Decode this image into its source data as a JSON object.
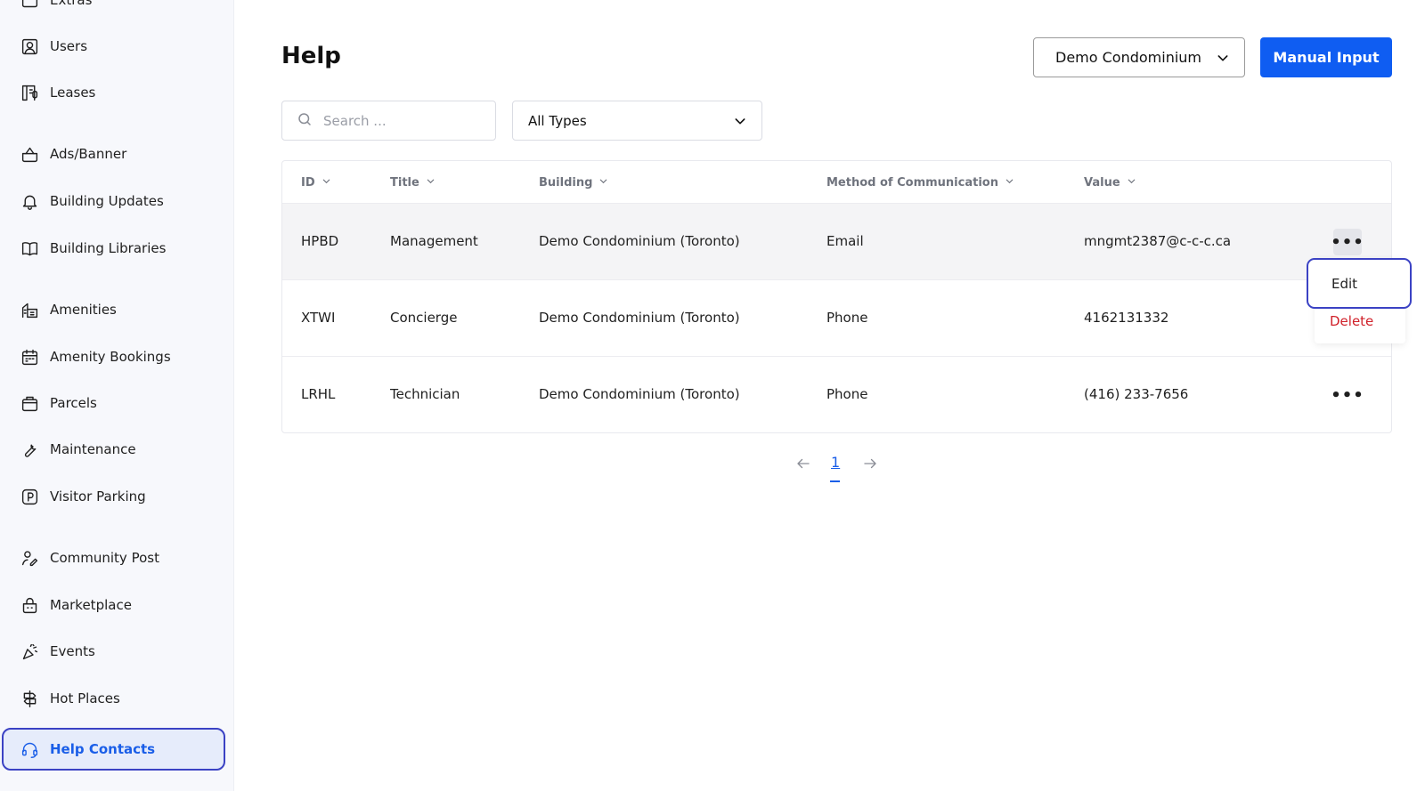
{
  "sidebar": {
    "items": [
      {
        "label": "Extras",
        "icon": "extras-icon"
      },
      {
        "label": "Users",
        "icon": "user-icon"
      },
      {
        "label": "Leases",
        "icon": "lease-icon"
      },
      {
        "label": "Ads/Banner",
        "icon": "basket-icon"
      },
      {
        "label": "Building Updates",
        "icon": "bell-icon"
      },
      {
        "label": "Building Libraries",
        "icon": "book-icon"
      },
      {
        "label": "Amenities",
        "icon": "building-icon"
      },
      {
        "label": "Amenity Bookings",
        "icon": "calendar-icon"
      },
      {
        "label": "Parcels",
        "icon": "parcel-icon"
      },
      {
        "label": "Maintenance",
        "icon": "wrench-icon"
      },
      {
        "label": "Visitor Parking",
        "icon": "parking-icon"
      },
      {
        "label": "Community Post",
        "icon": "community-icon"
      },
      {
        "label": "Marketplace",
        "icon": "marketplace-icon"
      },
      {
        "label": "Events",
        "icon": "party-icon"
      },
      {
        "label": "Hot Places",
        "icon": "signpost-icon"
      },
      {
        "label": "Help Contacts",
        "icon": "headset-icon",
        "active": true
      }
    ]
  },
  "header": {
    "title": "Help",
    "building_select": "Demo Condominium",
    "manual_input_label": "Manual Input"
  },
  "filters": {
    "search_placeholder": "Search ...",
    "type_select": "All Types"
  },
  "table": {
    "columns": [
      "ID",
      "Title",
      "Building",
      "Method of Communication",
      "Value"
    ],
    "rows": [
      {
        "id": "HPBD",
        "title": "Management",
        "building": "Demo Condominium (Toronto)",
        "method": "Email",
        "value": "mngmt2387@c-c-c.ca"
      },
      {
        "id": "XTWI",
        "title": "Concierge",
        "building": "Demo Condominium (Toronto)",
        "method": "Phone",
        "value": "4162131332"
      },
      {
        "id": "LRHL",
        "title": "Technician",
        "building": "Demo Condominium (Toronto)",
        "method": "Phone",
        "value": "(416) 233-7656"
      }
    ]
  },
  "row_menu": {
    "edit_label": "Edit",
    "delete_label": "Delete"
  },
  "pagination": {
    "current_page": "1"
  },
  "colors": {
    "primary": "#0f5df2",
    "active_link": "#1a5ee8",
    "focus_ring": "#3b42c4",
    "danger": "#d0212a"
  }
}
